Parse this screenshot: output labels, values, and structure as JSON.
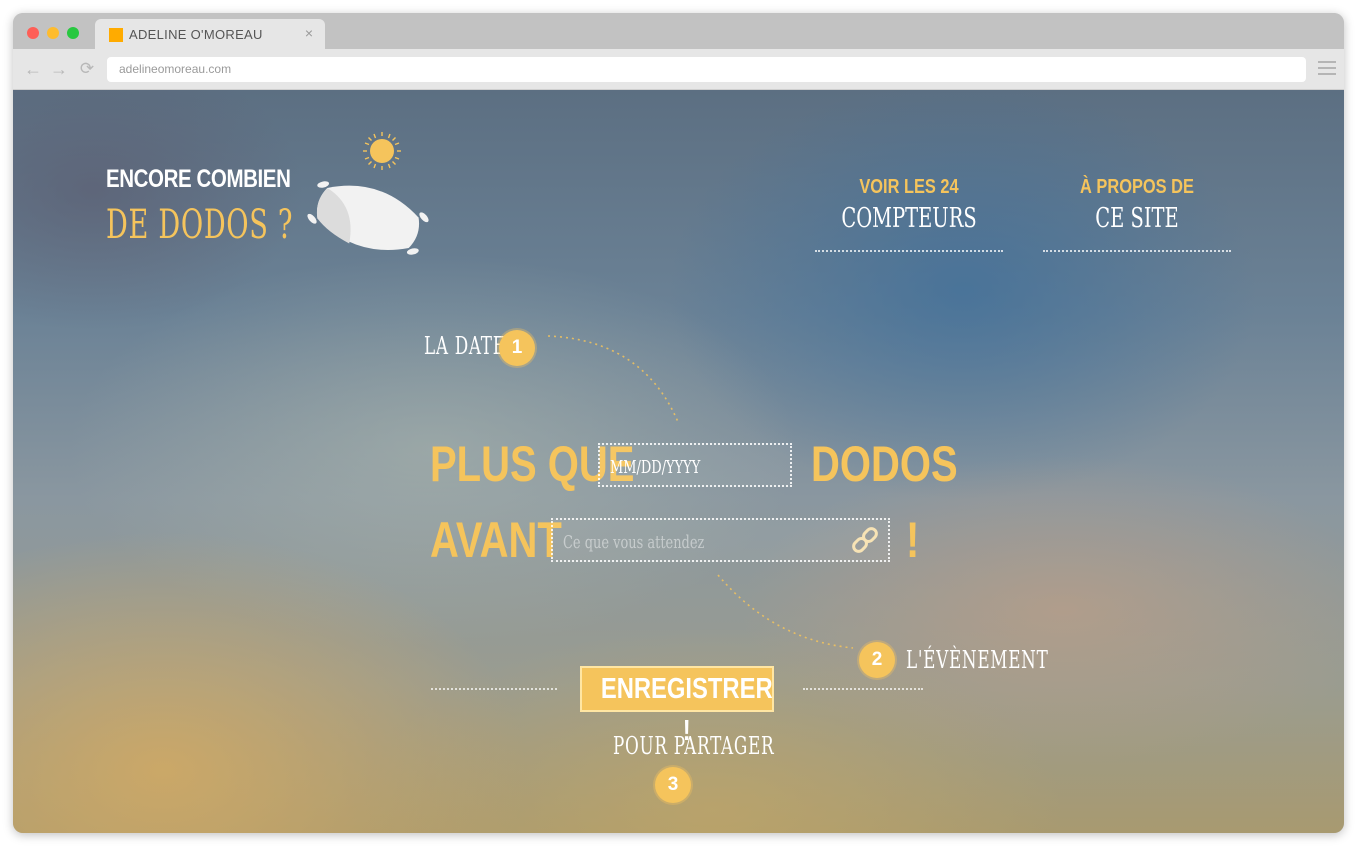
{
  "browser": {
    "tab_title": "ADELINE O'MOREAU",
    "url": "adelineomoreau.com",
    "close_glyph": "×",
    "back_glyph": "←",
    "forward_glyph": "→",
    "reload_glyph": "⟳"
  },
  "brand": {
    "line1": "ENCORE COMBIEN",
    "line2": "DE DODOS ?",
    "logo_icons": [
      "sun-icon",
      "pillow-icon"
    ]
  },
  "nav": {
    "counters": {
      "line1": "VOIR LES 24",
      "line2": "COMPTEURS"
    },
    "about": {
      "line1": "À PROPOS DE",
      "line2": "CE SITE"
    }
  },
  "form": {
    "step1": {
      "label": "LA DATE",
      "number": "1"
    },
    "step2": {
      "label": "L'ÉVÈNEMENT",
      "number": "2"
    },
    "step3": {
      "label": "POUR PARTAGER",
      "number": "3"
    },
    "plus_que": "PLUS QUE",
    "dodos": "DODOS",
    "avant": "AVANT",
    "exclamation": "!",
    "date_placeholder": "MM/DD/YYYY",
    "event_placeholder": "Ce que vous attendez",
    "submit_label": "ENREGISTRER !"
  },
  "colors": {
    "accent": "#f5c45c",
    "text_light": "#ffffff"
  }
}
